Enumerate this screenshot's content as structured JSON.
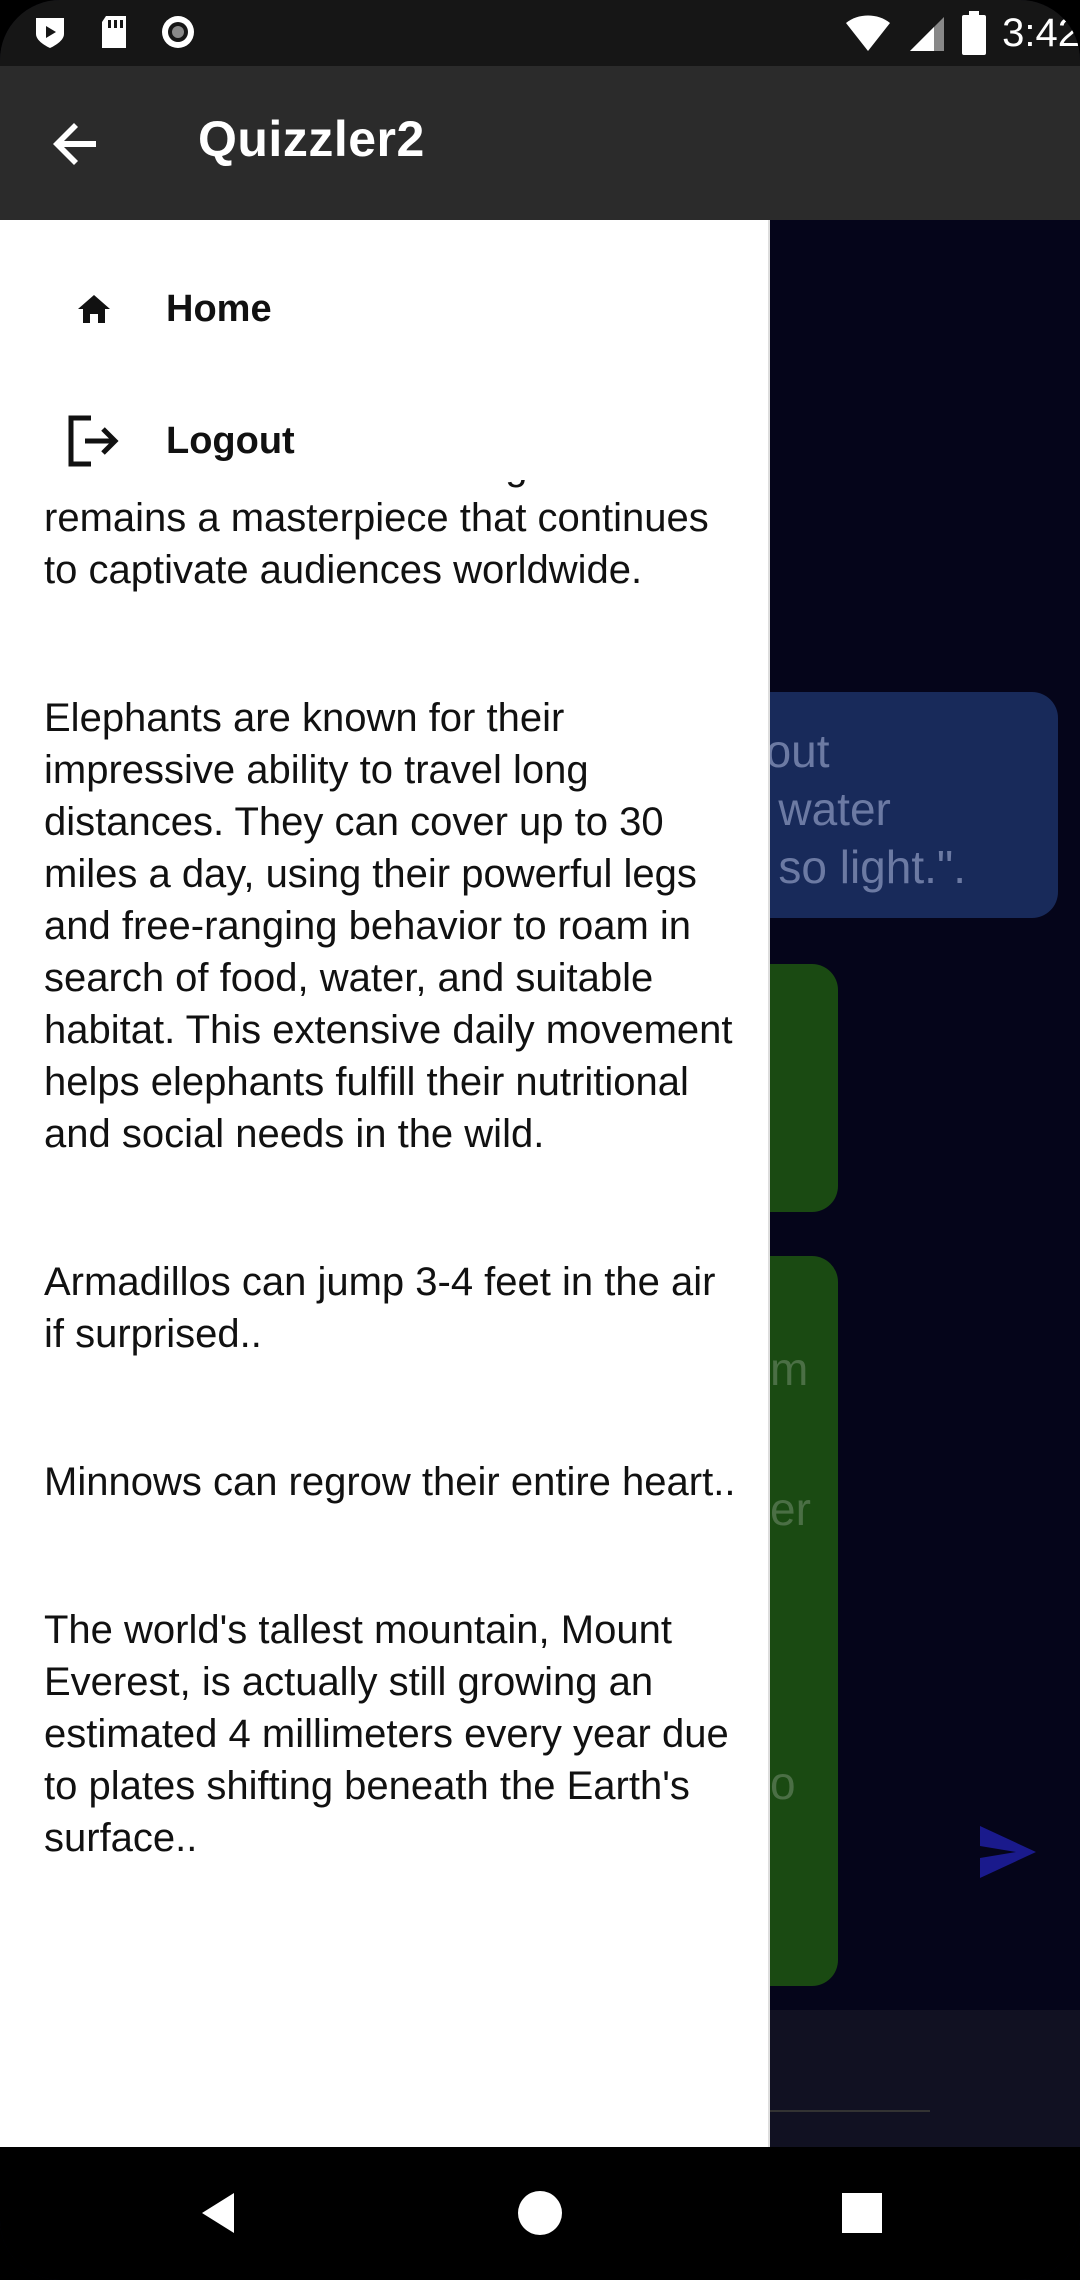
{
  "status_bar": {
    "time": "3:42",
    "icons": [
      "play-protect-icon",
      "sd-card-icon",
      "record-icon",
      "wifi-icon",
      "signal-icon",
      "battery-icon"
    ]
  },
  "app_bar": {
    "title": "Quizzler2",
    "back_icon": "arrow-back-icon"
  },
  "drawer": {
    "menu": [
      {
        "label": "Home",
        "icon": "home-icon"
      },
      {
        "label": "Logout",
        "icon": "logout-icon"
      }
    ],
    "facts": [
      "testament to Beethoven's genius and remains a masterpiece that continues to captivate audiences worldwide.",
      "Elephants are known for their impressive ability to travel long distances. They can cover up to 30 miles a day, using their powerful legs and free-ranging behavior to roam in search of food, water, and suitable habitat. This extensive daily movement helps elephants fulfill their nutritional and social needs in the wild.",
      "Armadillos can jump 3-4 feet in the air if surprised..",
      "Minnows can regrow their entire heart..",
      "The world's tallest mountain, Mount Everest, is actually still growing an estimated 4 millimeters every year due to plates shifting beneath the Earth's surface.."
    ]
  },
  "chat_background": {
    "blue_bubble_fragment": "bout n water e so light.\".",
    "green_fragments": [
      "m",
      "er",
      "o"
    ]
  },
  "colors": {
    "app_bar": "#2b2b2b",
    "drawer": "#ffffff",
    "chat_bg": "#05051a",
    "bubble_blue": "#182a5a",
    "bubble_green": "#1a4a12",
    "send_icon": "#1a1a8c"
  },
  "nav_bar": {
    "buttons": [
      "nav-back-icon",
      "nav-home-icon",
      "nav-recents-icon"
    ]
  }
}
